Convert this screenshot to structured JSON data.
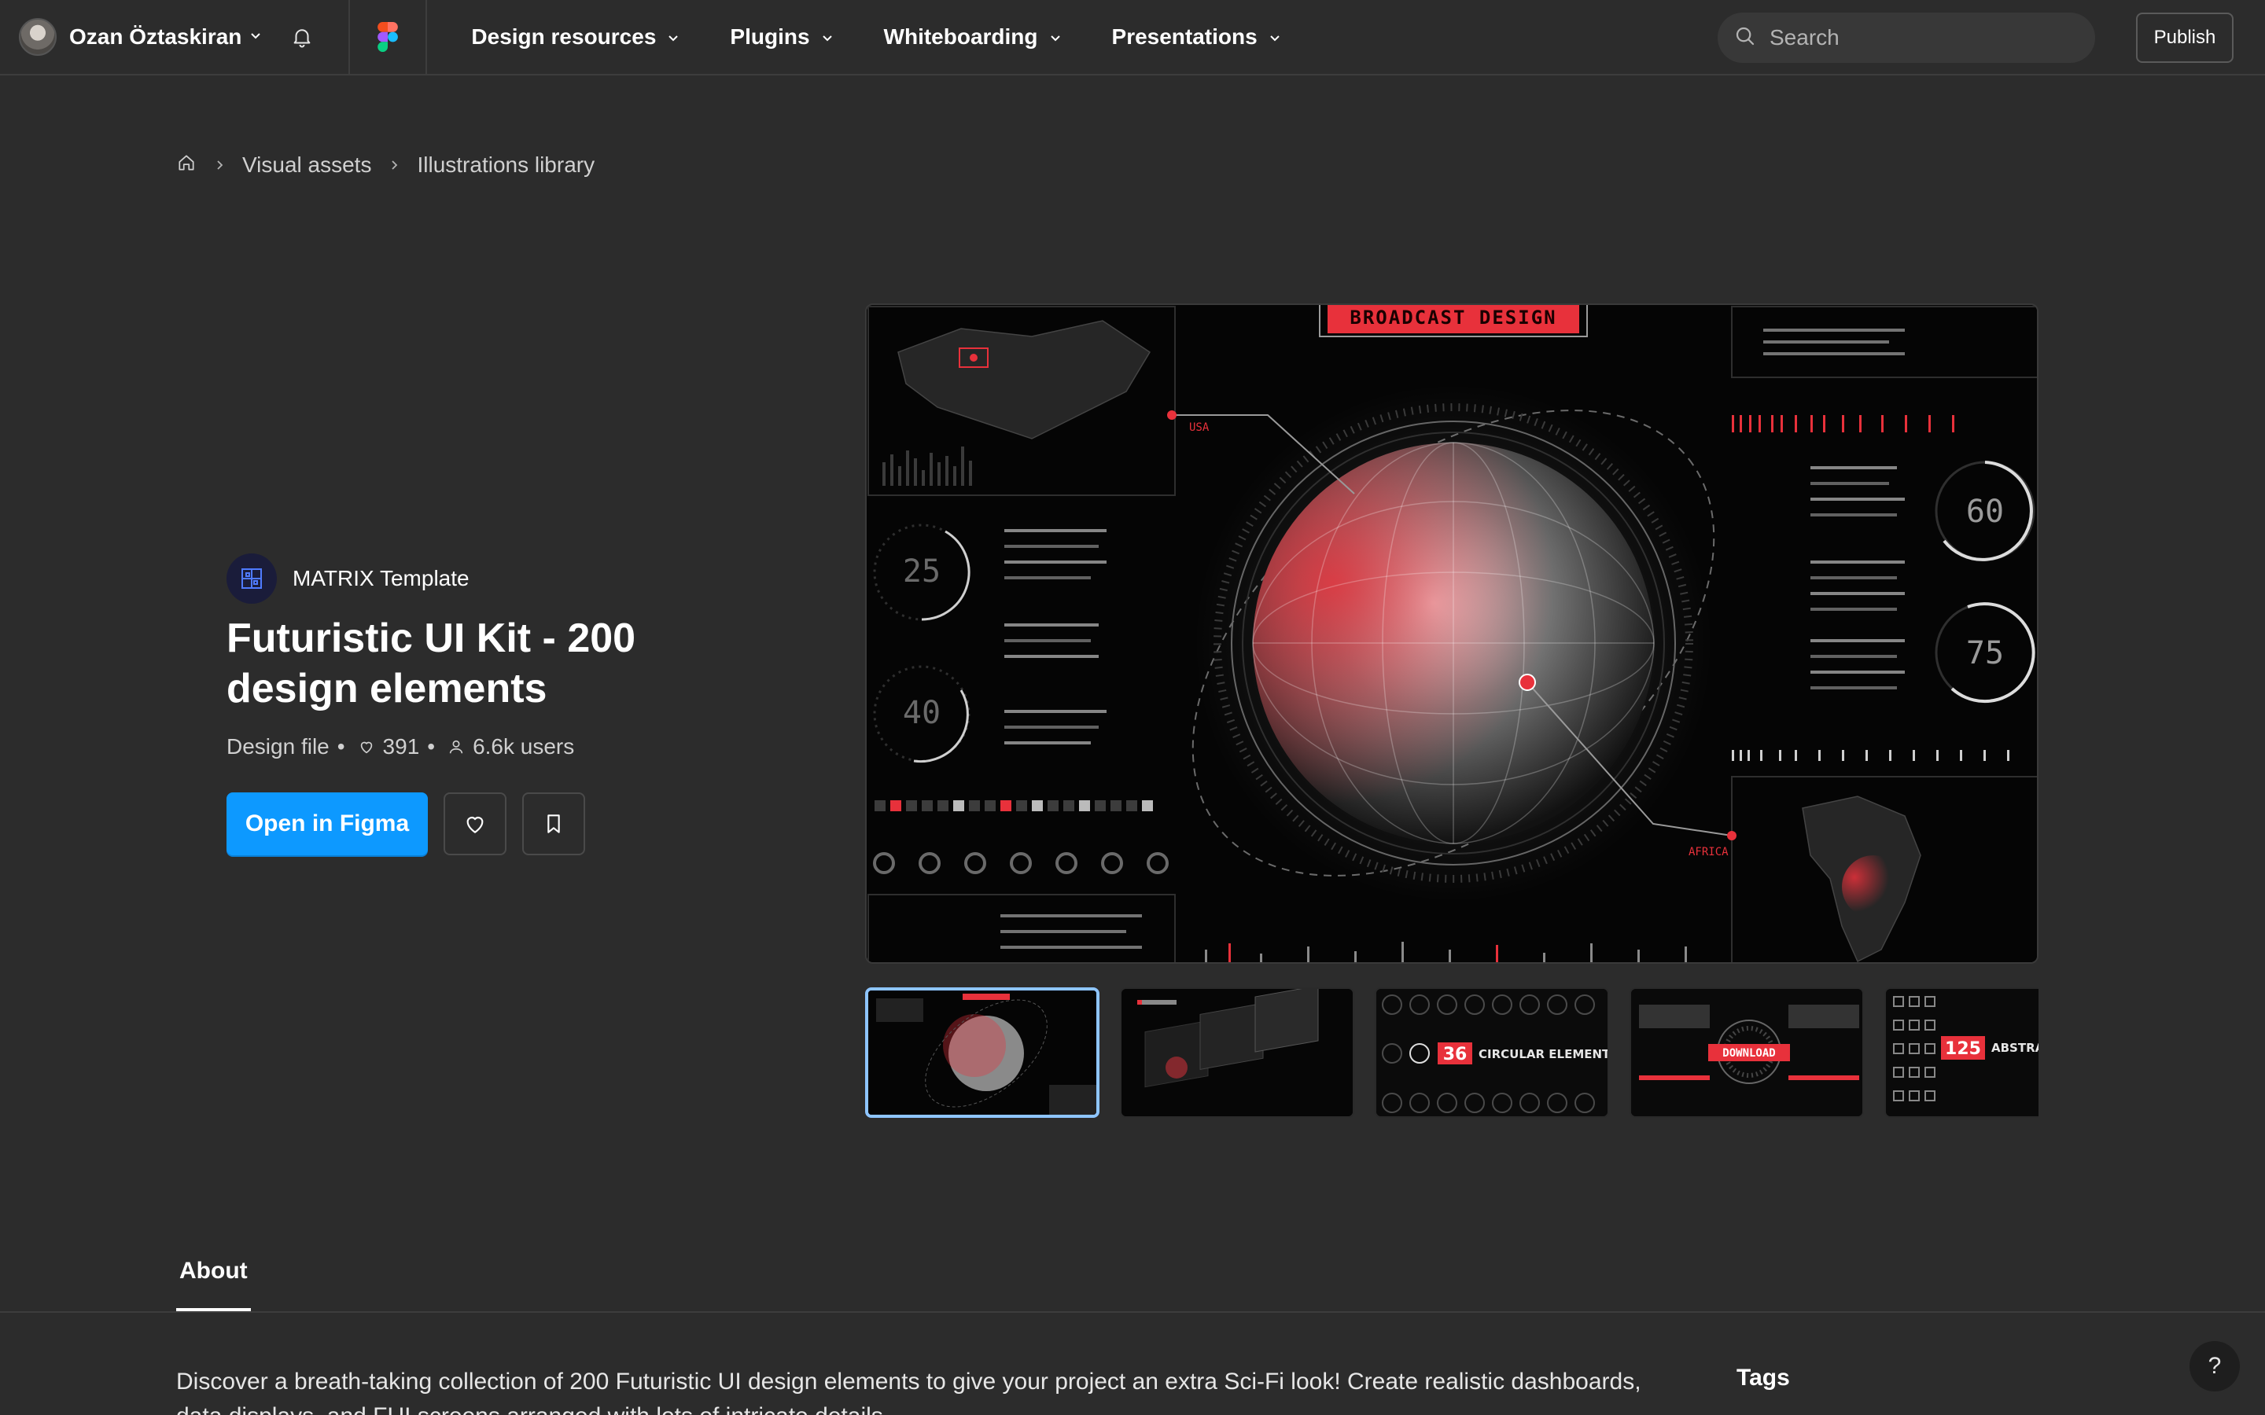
{
  "topbar": {
    "user_name": "Ozan Öztaskiran",
    "nav": [
      {
        "label": "Design resources"
      },
      {
        "label": "Plugins"
      },
      {
        "label": "Whiteboarding"
      },
      {
        "label": "Presentations"
      }
    ],
    "search_placeholder": "Search",
    "publish_label": "Publish"
  },
  "breadcrumb": {
    "items": [
      "Visual assets",
      "Illustrations library"
    ]
  },
  "resource": {
    "creator": "MATRIX Template",
    "title": "Futuristic UI Kit - 200 design elements",
    "type": "Design file",
    "likes": "391",
    "users": "6.6k users",
    "open_label": "Open in Figma"
  },
  "preview": {
    "banner": "BROADCAST DESIGN",
    "gauges": [
      "25",
      "40",
      "60",
      "75"
    ],
    "label_left": "USA",
    "label_right": "AFRICA"
  },
  "thumbnails": [
    {
      "caption_number": "",
      "caption_text": ""
    },
    {
      "caption_number": "",
      "caption_text": ""
    },
    {
      "caption_number": "36",
      "caption_text": "CIRCULAR ELEMENTS"
    },
    {
      "caption_number": "",
      "caption_text": "DOWNLOAD"
    },
    {
      "caption_number": "125",
      "caption_text": "ABSTRA ICONS"
    }
  ],
  "about": {
    "tab_label": "About",
    "description": "Discover a breath-taking collection of 200 Futuristic UI design elements to give your project an extra Sci-Fi look! Create realistic dashboards, data displays, and FUI screens arranged with lots of intricate details.",
    "tags_title": "Tags"
  },
  "help_label": "?",
  "colors": {
    "accent_blue": "#0d99ff",
    "hud_red": "#e8313b",
    "background": "#2c2c2c"
  }
}
